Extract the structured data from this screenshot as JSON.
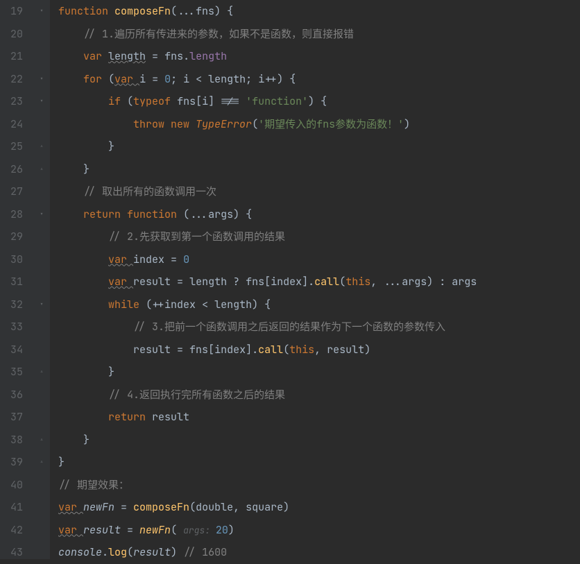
{
  "lines": [
    {
      "num": "19",
      "fold": "▾",
      "tokens": [
        {
          "t": "function ",
          "c": "keyword"
        },
        {
          "t": "composeFn",
          "c": "function-def"
        },
        {
          "t": "(...",
          "c": "operator"
        },
        {
          "t": "fns",
          "c": "param"
        },
        {
          "t": ") {",
          "c": "operator"
        }
      ]
    },
    {
      "num": "20",
      "fold": "",
      "tokens": [
        {
          "t": "    ",
          "c": ""
        },
        {
          "t": "// 1.遍历所有传进来的参数，如果不是函数，则直接报错",
          "c": "comment"
        }
      ]
    },
    {
      "num": "21",
      "fold": "",
      "tokens": [
        {
          "t": "    ",
          "c": ""
        },
        {
          "t": "var ",
          "c": "keyword"
        },
        {
          "t": "length",
          "c": "underline-wavy"
        },
        {
          "t": " = ",
          "c": "operator"
        },
        {
          "t": "fns",
          "c": "var-name"
        },
        {
          "t": ".",
          "c": "operator"
        },
        {
          "t": "length",
          "c": "property"
        }
      ]
    },
    {
      "num": "22",
      "fold": "▾",
      "tokens": [
        {
          "t": "    ",
          "c": ""
        },
        {
          "t": "for ",
          "c": "keyword"
        },
        {
          "t": "(",
          "c": "operator"
        },
        {
          "t": "var ",
          "c": "keyword underline-wavy"
        },
        {
          "t": "i",
          "c": "var-name"
        },
        {
          "t": " = ",
          "c": "operator"
        },
        {
          "t": "0",
          "c": "number"
        },
        {
          "t": "; ",
          "c": "operator"
        },
        {
          "t": "i",
          "c": "var-name"
        },
        {
          "t": " < ",
          "c": "operator"
        },
        {
          "t": "length",
          "c": "var-name"
        },
        {
          "t": "; ",
          "c": "operator"
        },
        {
          "t": "i",
          "c": "var-name"
        },
        {
          "t": "++) {",
          "c": "operator"
        }
      ]
    },
    {
      "num": "23",
      "fold": "▾",
      "tokens": [
        {
          "t": "        ",
          "c": ""
        },
        {
          "t": "if ",
          "c": "keyword"
        },
        {
          "t": "(",
          "c": "operator"
        },
        {
          "t": "typeof ",
          "c": "keyword"
        },
        {
          "t": "fns",
          "c": "var-name"
        },
        {
          "t": "[",
          "c": "operator"
        },
        {
          "t": "i",
          "c": "var-name"
        },
        {
          "t": "] !== ",
          "c": "operator"
        },
        {
          "t": "'function'",
          "c": "string"
        },
        {
          "t": ") {",
          "c": "operator"
        }
      ]
    },
    {
      "num": "24",
      "fold": "",
      "tokens": [
        {
          "t": "            ",
          "c": ""
        },
        {
          "t": "throw ",
          "c": "keyword"
        },
        {
          "t": "new ",
          "c": "keyword"
        },
        {
          "t": "TypeError",
          "c": "type-error italic"
        },
        {
          "t": "(",
          "c": "operator"
        },
        {
          "t": "'期望传入的fns参数为函数！'",
          "c": "string"
        },
        {
          "t": ")",
          "c": "operator"
        }
      ]
    },
    {
      "num": "25",
      "fold": "▵",
      "tokens": [
        {
          "t": "        }",
          "c": "operator"
        }
      ]
    },
    {
      "num": "26",
      "fold": "▵",
      "tokens": [
        {
          "t": "    }",
          "c": "operator"
        }
      ]
    },
    {
      "num": "27",
      "fold": "",
      "tokens": [
        {
          "t": "    ",
          "c": ""
        },
        {
          "t": "// 取出所有的函数调用一次",
          "c": "comment"
        }
      ]
    },
    {
      "num": "28",
      "fold": "▾",
      "tokens": [
        {
          "t": "    ",
          "c": ""
        },
        {
          "t": "return ",
          "c": "keyword"
        },
        {
          "t": "function ",
          "c": "keyword"
        },
        {
          "t": "(...",
          "c": "operator"
        },
        {
          "t": "args",
          "c": "param"
        },
        {
          "t": ") {",
          "c": "operator"
        }
      ]
    },
    {
      "num": "29",
      "fold": "",
      "tokens": [
        {
          "t": "        ",
          "c": ""
        },
        {
          "t": "// 2.先获取到第一个函数调用的结果",
          "c": "comment"
        }
      ]
    },
    {
      "num": "30",
      "fold": "",
      "tokens": [
        {
          "t": "        ",
          "c": ""
        },
        {
          "t": "var ",
          "c": "keyword underline-wavy"
        },
        {
          "t": "index",
          "c": "var-name"
        },
        {
          "t": " = ",
          "c": "operator"
        },
        {
          "t": "0",
          "c": "number"
        }
      ]
    },
    {
      "num": "31",
      "fold": "",
      "tokens": [
        {
          "t": "        ",
          "c": ""
        },
        {
          "t": "var ",
          "c": "keyword underline-wavy"
        },
        {
          "t": "result",
          "c": "var-name"
        },
        {
          "t": " = ",
          "c": "operator"
        },
        {
          "t": "length",
          "c": "var-name"
        },
        {
          "t": " ? ",
          "c": "operator"
        },
        {
          "t": "fns",
          "c": "var-name"
        },
        {
          "t": "[",
          "c": "operator"
        },
        {
          "t": "index",
          "c": "var-name"
        },
        {
          "t": "].",
          "c": "operator"
        },
        {
          "t": "call",
          "c": "function-call"
        },
        {
          "t": "(",
          "c": "operator"
        },
        {
          "t": "this",
          "c": "this-keyword"
        },
        {
          "t": ", ...",
          "c": "operator"
        },
        {
          "t": "args",
          "c": "var-name"
        },
        {
          "t": ") : ",
          "c": "operator"
        },
        {
          "t": "args",
          "c": "var-name"
        }
      ]
    },
    {
      "num": "32",
      "fold": "▾",
      "tokens": [
        {
          "t": "        ",
          "c": ""
        },
        {
          "t": "while ",
          "c": "keyword"
        },
        {
          "t": "(++",
          "c": "operator"
        },
        {
          "t": "index",
          "c": "var-name"
        },
        {
          "t": " < ",
          "c": "operator"
        },
        {
          "t": "length",
          "c": "var-name"
        },
        {
          "t": ") {",
          "c": "operator"
        }
      ]
    },
    {
      "num": "33",
      "fold": "",
      "tokens": [
        {
          "t": "            ",
          "c": ""
        },
        {
          "t": "// 3.把前一个函数调用之后返回的结果作为下一个函数的参数传入",
          "c": "comment"
        }
      ]
    },
    {
      "num": "34",
      "fold": "",
      "tokens": [
        {
          "t": "            ",
          "c": ""
        },
        {
          "t": "result",
          "c": "var-name"
        },
        {
          "t": " = ",
          "c": "operator"
        },
        {
          "t": "fns",
          "c": "var-name"
        },
        {
          "t": "[",
          "c": "operator"
        },
        {
          "t": "index",
          "c": "var-name"
        },
        {
          "t": "].",
          "c": "operator"
        },
        {
          "t": "call",
          "c": "function-call"
        },
        {
          "t": "(",
          "c": "operator"
        },
        {
          "t": "this",
          "c": "this-keyword"
        },
        {
          "t": ", ",
          "c": "operator"
        },
        {
          "t": "result",
          "c": "var-name"
        },
        {
          "t": ")",
          "c": "operator"
        }
      ]
    },
    {
      "num": "35",
      "fold": "▵",
      "tokens": [
        {
          "t": "        }",
          "c": "operator"
        }
      ]
    },
    {
      "num": "36",
      "fold": "",
      "tokens": [
        {
          "t": "        ",
          "c": ""
        },
        {
          "t": "// 4.返回执行完所有函数之后的结果",
          "c": "comment"
        }
      ]
    },
    {
      "num": "37",
      "fold": "",
      "tokens": [
        {
          "t": "        ",
          "c": ""
        },
        {
          "t": "return ",
          "c": "keyword"
        },
        {
          "t": "result",
          "c": "var-name"
        }
      ]
    },
    {
      "num": "38",
      "fold": "▵",
      "tokens": [
        {
          "t": "    }",
          "c": "operator"
        }
      ]
    },
    {
      "num": "39",
      "fold": "▵",
      "tokens": [
        {
          "t": "}",
          "c": "operator"
        }
      ]
    },
    {
      "num": "40",
      "fold": "",
      "tokens": [
        {
          "t": "// 期望效果：",
          "c": "comment"
        }
      ]
    },
    {
      "num": "41",
      "fold": "",
      "tokens": [
        {
          "t": "var ",
          "c": "keyword underline-wavy"
        },
        {
          "t": "newFn",
          "c": "var-name italic"
        },
        {
          "t": " = ",
          "c": "operator"
        },
        {
          "t": "composeFn",
          "c": "function-call"
        },
        {
          "t": "(",
          "c": "operator"
        },
        {
          "t": "double",
          "c": "var-name"
        },
        {
          "t": ", ",
          "c": "operator"
        },
        {
          "t": "square",
          "c": "var-name"
        },
        {
          "t": ")",
          "c": "operator"
        }
      ]
    },
    {
      "num": "42",
      "fold": "",
      "tokens": [
        {
          "t": "var ",
          "c": "keyword underline-wavy"
        },
        {
          "t": "result",
          "c": "var-name italic"
        },
        {
          "t": " = ",
          "c": "operator"
        },
        {
          "t": "newFn",
          "c": "function-call italic"
        },
        {
          "t": "( ",
          "c": "operator"
        },
        {
          "t": "args: ",
          "c": "inline-hint"
        },
        {
          "t": "20",
          "c": "number"
        },
        {
          "t": ")",
          "c": "operator"
        }
      ]
    },
    {
      "num": "43",
      "fold": "",
      "tokens": [
        {
          "t": "console",
          "c": "console-italic"
        },
        {
          "t": ".",
          "c": "operator"
        },
        {
          "t": "log",
          "c": "function-call"
        },
        {
          "t": "(",
          "c": "operator"
        },
        {
          "t": "result",
          "c": "var-name italic"
        },
        {
          "t": ") ",
          "c": "operator"
        },
        {
          "t": "// 1600",
          "c": "comment"
        }
      ]
    }
  ]
}
